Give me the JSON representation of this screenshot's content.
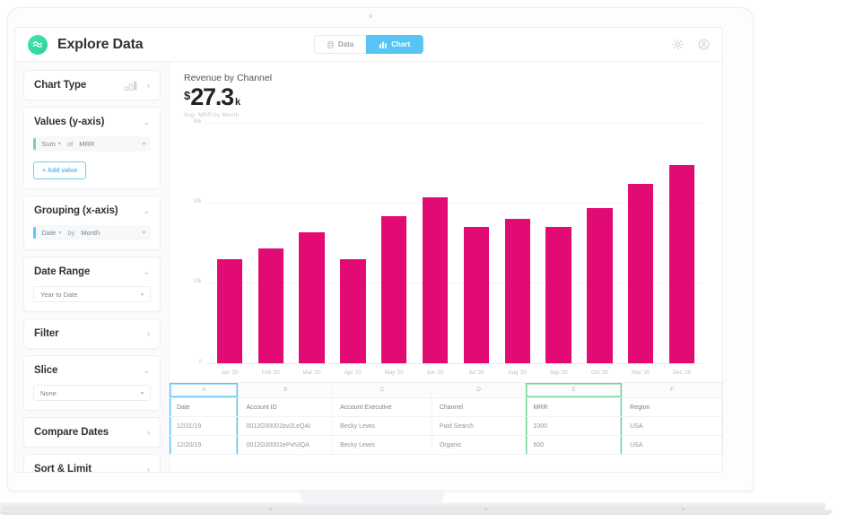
{
  "app": {
    "title": "Explore Data",
    "logo_icon": "waves-logo-icon",
    "tabs": [
      {
        "label": "Data",
        "icon": "database-icon",
        "active": false
      },
      {
        "label": "Chart",
        "icon": "bar-chart-icon",
        "active": true
      }
    ],
    "header_icons": [
      {
        "name": "gear-icon"
      },
      {
        "name": "user-avatar-icon"
      }
    ]
  },
  "sidebar": {
    "sections": [
      {
        "title": "Chart Type",
        "icon": "bar-chart-icon",
        "chevron": "›",
        "expanded": false
      },
      {
        "title": "Values (y-axis)",
        "chevron": "⌄",
        "expanded": true,
        "accent": "#6fd99b",
        "agg_label": "Sum",
        "of_label": "of",
        "field_label": "MRR",
        "add_label": "+ Add value"
      },
      {
        "title": "Grouping (x-axis)",
        "chevron": "⌄",
        "expanded": true,
        "accent": "#62c6f2",
        "dim_label": "Date",
        "by_label": "by",
        "grain_label": "Month"
      },
      {
        "title": "Date Range",
        "chevron": "⌄",
        "expanded": true,
        "value": "Year to Date"
      },
      {
        "title": "Filter",
        "chevron": "›",
        "expanded": false
      },
      {
        "title": "Slice",
        "chevron": "⌄",
        "expanded": true,
        "value": "None"
      },
      {
        "title": "Compare Dates",
        "chevron": "›",
        "expanded": false
      },
      {
        "title": "Sort & Limit",
        "chevron": "›",
        "expanded": false
      }
    ]
  },
  "chart_header": {
    "title": "Revenue by Channel",
    "currency": "$",
    "value": "27.3",
    "suffix": "k",
    "caption": "Avg. MRR by Month"
  },
  "chart_data": {
    "type": "bar",
    "title": "Revenue by Channel",
    "subtitle": "Avg. MRR by Month",
    "xlabel": "",
    "ylabel": "",
    "ylim": [
      0,
      45000
    ],
    "grid": true,
    "legend": "none",
    "bar_color": "#e20b74",
    "ytick_labels": [
      "0",
      "15k",
      "30k",
      "45k"
    ],
    "ytick_values": [
      0,
      15000,
      30000,
      45000
    ],
    "categories": [
      "Jan '20",
      "Feb '20",
      "Mar '20",
      "Apr '20",
      "May '20",
      "Jun '20",
      "Jul '20",
      "Aug '20",
      "Sep '20",
      "Oct '20",
      "Nov '20",
      "Dec '20"
    ],
    "values": [
      19500,
      21500,
      24500,
      19500,
      27500,
      31000,
      25500,
      27000,
      25500,
      29000,
      33500,
      37000
    ]
  },
  "data_table": {
    "column_letters": [
      "A",
      "B",
      "C",
      "D",
      "E",
      "F"
    ],
    "selected_columns": [
      "A",
      "E"
    ],
    "field_row": [
      "Date",
      "Account ID",
      "Account Executive",
      "Channel",
      "MRR",
      "Region"
    ],
    "rows": [
      [
        "12/31/19",
        "0012G00001bv2LeQAI",
        "Becky Lewis",
        "Paid Search",
        "1000",
        "USA"
      ],
      [
        "12/20/19",
        "0012G00001ePvh3QA",
        "Becky Lewis",
        "Organic",
        "600",
        "USA"
      ]
    ]
  },
  "colors": {
    "accent_pink": "#e20b74",
    "accent_blue": "#56c4f5",
    "accent_green": "#6fd99b",
    "logo_green": "#35d9a5"
  }
}
